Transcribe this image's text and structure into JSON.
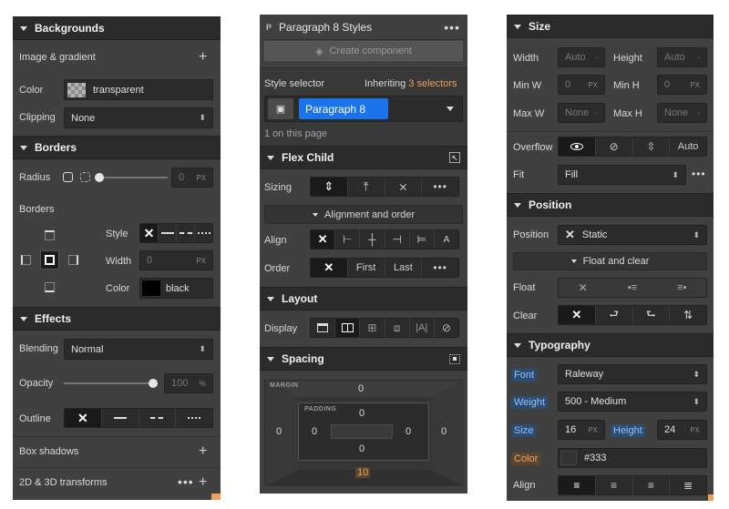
{
  "panel1": {
    "backgrounds": {
      "title": "Backgrounds",
      "image_gradient_label": "Image & gradient",
      "color_label": "Color",
      "color_value": "transparent",
      "clipping_label": "Clipping",
      "clipping_value": "None"
    },
    "borders": {
      "title": "Borders",
      "radius_label": "Radius",
      "radius_value": "0",
      "radius_unit": "PX",
      "borders_label": "Borders",
      "style_label": "Style",
      "width_label": "Width",
      "width_value": "0",
      "width_unit": "PX",
      "color_label": "Color",
      "color_value": "black"
    },
    "effects": {
      "title": "Effects",
      "blending_label": "Blending",
      "blending_value": "Normal",
      "opacity_label": "Opacity",
      "opacity_value": "100",
      "opacity_unit": "%",
      "outline_label": "Outline",
      "box_shadows_label": "Box shadows",
      "transforms_label": "2D & 3D transforms"
    }
  },
  "panel2": {
    "header_badge": "P",
    "title": "Paragraph 8 Styles",
    "create_component": "Create component",
    "style_selector_label": "Style selector",
    "inheriting_prefix": "Inheriting",
    "inheriting_count": "3 selectors",
    "selector_value": "Paragraph 8",
    "on_page": "1 on this page",
    "flex_child": {
      "title": "Flex Child",
      "sizing_label": "Sizing",
      "alignment_order": "Alignment and order",
      "align_label": "Align",
      "order_label": "Order",
      "order_first": "First",
      "order_last": "Last"
    },
    "layout": {
      "title": "Layout",
      "display_label": "Display"
    },
    "spacing": {
      "title": "Spacing",
      "margin_label": "MARGIN",
      "padding_label": "PADDING",
      "margin_top": "0",
      "margin_left": "0",
      "margin_right": "0",
      "margin_bottom": "10",
      "padding_top": "0",
      "padding_left": "0",
      "padding_right": "0",
      "padding_bottom": "0"
    }
  },
  "panel3": {
    "size": {
      "title": "Size",
      "width_label": "Width",
      "width_value": "Auto",
      "height_label": "Height",
      "height_value": "Auto",
      "minw_label": "Min W",
      "minw_value": "0",
      "minh_label": "Min H",
      "minh_value": "0",
      "maxw_label": "Max W",
      "maxw_value": "None",
      "maxh_label": "Max H",
      "maxh_value": "None",
      "px": "PX",
      "dash": "-",
      "overflow_label": "Overflow",
      "overflow_auto": "Auto",
      "fit_label": "Fit",
      "fit_value": "Fill"
    },
    "position": {
      "title": "Position",
      "position_label": "Position",
      "position_value": "Static",
      "float_clear": "Float and clear",
      "float_label": "Float",
      "clear_label": "Clear"
    },
    "typography": {
      "title": "Typography",
      "font_label": "Font",
      "font_value": "Raleway",
      "weight_label": "Weight",
      "weight_value": "500 - Medium",
      "size_label": "Size",
      "size_value": "16",
      "size_unit": "PX",
      "height_label": "Height",
      "height_value": "24",
      "height_unit": "PX",
      "color_label": "Color",
      "color_value": "#333",
      "align_label": "Align"
    }
  },
  "colors": {
    "panel_bg": "#404040",
    "header_bg": "#2b2b2b",
    "accent_blue": "#1a73e8",
    "accent_orange": "#f0a15b"
  }
}
